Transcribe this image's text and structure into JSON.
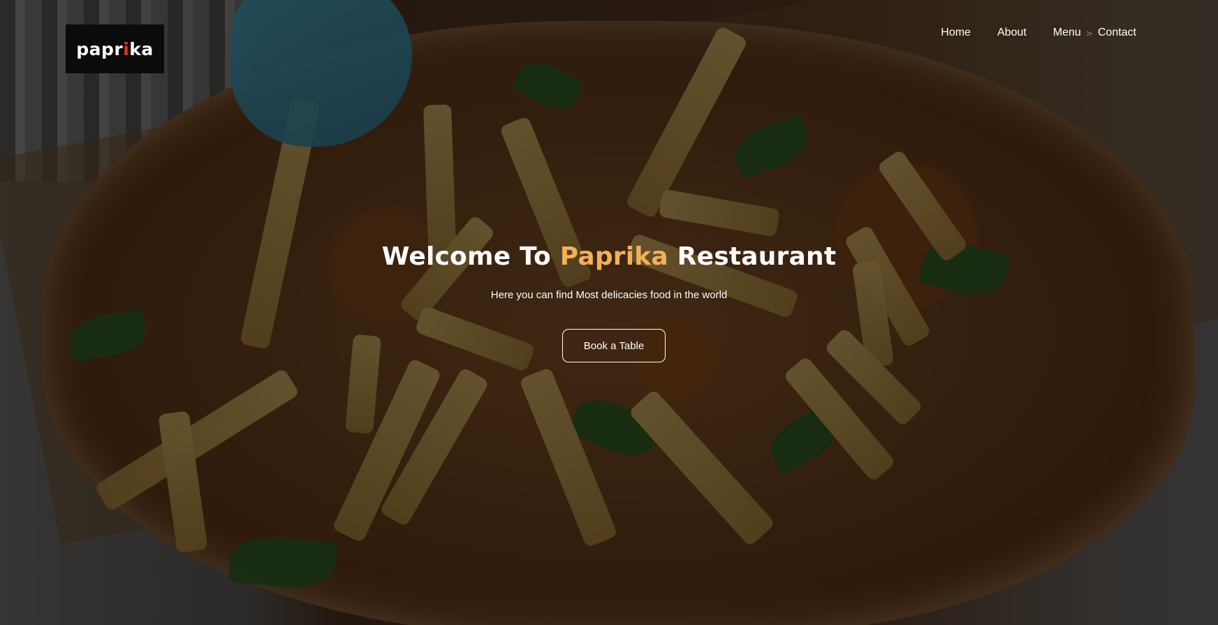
{
  "logo": {
    "part1": "papr",
    "accent": "i",
    "part2": "ka",
    "accent_color": "#e53225"
  },
  "nav": {
    "items": [
      {
        "label": "Home"
      },
      {
        "label": "About"
      },
      {
        "label": "Menu"
      },
      {
        "label": "Contact"
      }
    ],
    "separator": ">"
  },
  "hero": {
    "headline_pre": "Welcome To",
    "headline_accent": "Paprika",
    "headline_post": "Restaurant",
    "accent_color": "#f2b15a",
    "tagline": "Here you can find Most delicacies food in the world",
    "cta_label": "Book a Table",
    "background_icon": "pizza-photo"
  }
}
